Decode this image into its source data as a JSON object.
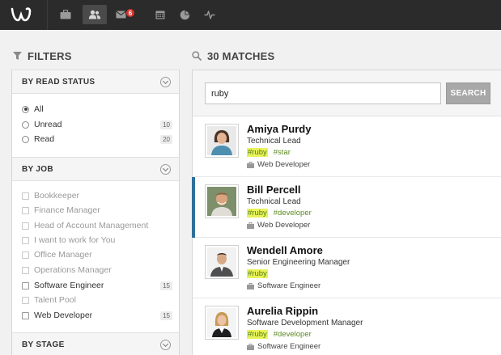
{
  "nav": {
    "items": [
      {
        "name": "briefcase-icon",
        "active": false
      },
      {
        "name": "people-icon",
        "active": true
      },
      {
        "name": "mail-icon",
        "active": false,
        "badge": "6"
      },
      {
        "name": "calendar-icon",
        "active": false
      },
      {
        "name": "pie-chart-icon",
        "active": false
      },
      {
        "name": "activity-icon",
        "active": false
      }
    ]
  },
  "filters": {
    "title": "FILTERS",
    "read_status": {
      "title": "BY READ STATUS",
      "options": [
        {
          "label": "All",
          "selected": true
        },
        {
          "label": "Unread",
          "count": "10"
        },
        {
          "label": "Read",
          "count": "20"
        }
      ]
    },
    "job": {
      "title": "BY JOB",
      "options": [
        {
          "label": "Bookkeeper"
        },
        {
          "label": "Finance Manager"
        },
        {
          "label": "Head of Account Management"
        },
        {
          "label": "I want to work for You"
        },
        {
          "label": "Office Manager"
        },
        {
          "label": "Operations Manager"
        },
        {
          "label": "Software Engineer",
          "count": "15"
        },
        {
          "label": "Talent Pool"
        },
        {
          "label": "Web Developer",
          "count": "15"
        }
      ]
    },
    "stage": {
      "title": "BY STAGE"
    }
  },
  "matches": {
    "title": "30 MATCHES",
    "search_value": "ruby",
    "search_button": "SEARCH",
    "candidates": [
      {
        "name": "Amiya Purdy",
        "role": "Technical Lead",
        "tags": [
          "#ruby",
          "#star"
        ],
        "job": "Web Developer"
      },
      {
        "name": "Bill Percell",
        "role": "Technical Lead",
        "tags": [
          "#ruby",
          "#developer"
        ],
        "job": "Web Developer"
      },
      {
        "name": "Wendell Amore",
        "role": "Senior Engineering Manager",
        "tags": [
          "#ruby"
        ],
        "job": "Software Engineer"
      },
      {
        "name": "Aurelia Rippin",
        "role": "Software Development Manager",
        "tags": [
          "#ruby",
          "#developer"
        ],
        "job": "Software Engineer"
      }
    ]
  },
  "colors": {
    "topbar": "#2b2b2b",
    "accent": "#2f6f99",
    "badge": "#d9342b",
    "highlight": "#e8f25a",
    "tag": "#5a8a1e"
  }
}
